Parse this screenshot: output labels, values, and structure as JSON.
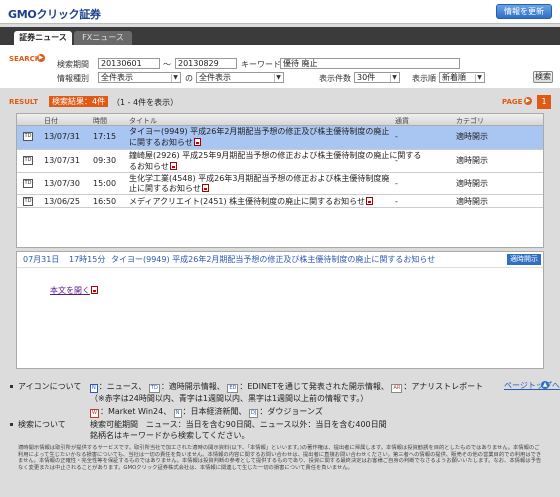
{
  "header": {
    "logo_prefix": "GMO",
    "logo_suffix": "クリック証券",
    "refresh_label": "情報を更新"
  },
  "tabs": [
    {
      "label": "証券ニュース",
      "active": true
    },
    {
      "label": "FXニュース",
      "active": false
    }
  ],
  "search": {
    "section_label": "SEARCH",
    "period_label": "検索期間",
    "date_from": "20130601",
    "date_sep": "～",
    "date_to": "20130829",
    "keyword_label": "キーワード",
    "keyword_value": "優待 廃止",
    "info_type_label": "情報種別",
    "info_type_value": "全件表示",
    "no_label": "の",
    "sub_type_value": "全件表示",
    "count_label": "表示件数",
    "count_value": "30件",
    "order_label": "表示順",
    "order_value": "新着順",
    "search_button": "検索"
  },
  "results": {
    "section_label": "RESULT",
    "badge": "検索結果：4件",
    "range": "（1 - 4件を表示）",
    "page_label": "PAGE",
    "current_page": "1",
    "columns": [
      "日付",
      "時間",
      "タイトル",
      "通貨",
      "カテゴリ"
    ],
    "rows": [
      {
        "icon": "TD",
        "date": "13/07/31",
        "time": "17:15",
        "title1": "タイヨー(9949) 平成26年2月期配当予想の修正及び株主優待制度の廃止",
        "title2": "に関するお知らせ",
        "currency": "-",
        "category": "適時開示",
        "selected": true
      },
      {
        "icon": "TD",
        "date": "13/07/31",
        "time": "09:30",
        "title1": "鐘崎屋(2926) 平成25年9月期配当予想の修正および株主優待制度の廃止に関する",
        "title2": "るお知らせ",
        "currency": "-",
        "category": "適時開示",
        "selected": false
      },
      {
        "icon": "TD",
        "date": "13/07/30",
        "time": "15:00",
        "title1": "生化学工業(4548) 平成26年3月期配当予想の修正および株主優待制度廃",
        "title2": "止に関するお知らせ",
        "currency": "-",
        "category": "適時開示",
        "selected": false
      },
      {
        "icon": "TD",
        "date": "13/06/25",
        "time": "16:50",
        "title1": "メディアクリエイト(2451) 株主優待制度の廃止に関するお知らせ",
        "title2": "",
        "currency": "-",
        "category": "適時開示",
        "selected": false
      }
    ]
  },
  "detail": {
    "date": "07月31日",
    "time": "17時15分",
    "title": "タイヨー(9949) 平成26年2月期配当予想の修正及び株主優待制度の廃止に関するお知らせ",
    "category": "適時開示",
    "open_link": "本文を開く"
  },
  "legend": {
    "icons_label": "アイコンについて",
    "n_icon": "N",
    "n_text": "：ニュース、",
    "td_icon": "TD",
    "td_text": "：適時開示情報、",
    "ed_icon": "ED",
    "ed_text": "：EDINETを通じて発表された開示情報、",
    "ar_icon": "AR",
    "ar_text": "：アナリストレポート",
    "color_note": "（※赤字は24時間以内、青字は1週間以内、黒字は1週間以上前の情報です。）",
    "w_icon": "W",
    "w_text": "：Market Win24、",
    "nk_icon": "N",
    "nk_text": "：日本経済新聞、",
    "dj_icon": "DJ",
    "dj_text": "：ダウジョーンズ",
    "page_top": "ページトップへ",
    "search_label": "検索について",
    "search_note1": "検索可能期間　ニュース：当日を含む90日間、ニュース以外：当日を含む400日間",
    "search_note2": "銘柄名はキーワードから検索してください。"
  },
  "disclaimer": "適時開示情報は取引所が提供するサービスです。取引所当社で加工された適時の開示資料(以下、「本情報」といいます。)の著作権は、提出者に帰属します。本情報は投資勧誘を目的としたものではありません。本情報のご利用によって生じたいかなる損害についても、当社は一切の責任を負いません。本情報の内容に関するお問い合わせは、提出者に直接お問い合わせください。第三者への情報の提供、販売その他の営業目的での利用はできません。本情報の正確性・完全性等を保証するものではありません。本情報は投資判断の参考として提供するものであり、投資に関する最終決定はお客様ご自身の判断でなさるようお願いいたします。なお、本情報は予告なく変更または中止されることがあります。GMOクリック証券株式会社は、本情報に関連して生じた一切の損害について責任を負いません。"
}
